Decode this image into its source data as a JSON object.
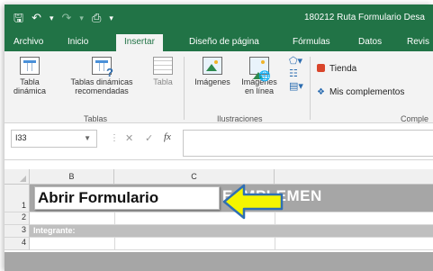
{
  "titlebar": {
    "document_title": "180212 Ruta Formulario Desa",
    "qat_icons": [
      "save-icon",
      "undo-icon",
      "redo-icon",
      "print-preview-icon",
      "customize-qat-icon"
    ]
  },
  "tabs": [
    "Archivo",
    "Inicio",
    "Insertar",
    "Diseño de página",
    "Fórmulas",
    "Datos",
    "Revis"
  ],
  "active_tab": "Insertar",
  "ribbon": {
    "tablas": {
      "pivot_line1": "Tabla",
      "pivot_line2": "dinámica",
      "recommended_line1": "Tablas dinámicas",
      "recommended_line2": "recomendadas",
      "table": "Tabla",
      "group": "Tablas"
    },
    "ilustraciones": {
      "images": "Imágenes",
      "online_line1": "Imágenes",
      "online_line2": "en línea",
      "group": "Ilustraciones"
    },
    "complementos": {
      "store": "Tienda",
      "my_addins": "Mis complementos",
      "group": "Comple"
    }
  },
  "formula_bar": {
    "name_box": "I33",
    "cancel": "✕",
    "enter": "✓",
    "fx": "fx",
    "value": ""
  },
  "grid": {
    "columns": [
      "B",
      "C"
    ],
    "rows": [
      "1",
      "2",
      "3",
      "4"
    ],
    "banner_text": "E IMPLEMEN",
    "button_label": "Abrir Formulario",
    "integrante_label": "Integrante:"
  },
  "colors": {
    "excel_green": "#217346",
    "banner_gray": "#a6a6a6",
    "arrow_fill": "#f5f500",
    "arrow_stroke": "#2f6fb3"
  }
}
